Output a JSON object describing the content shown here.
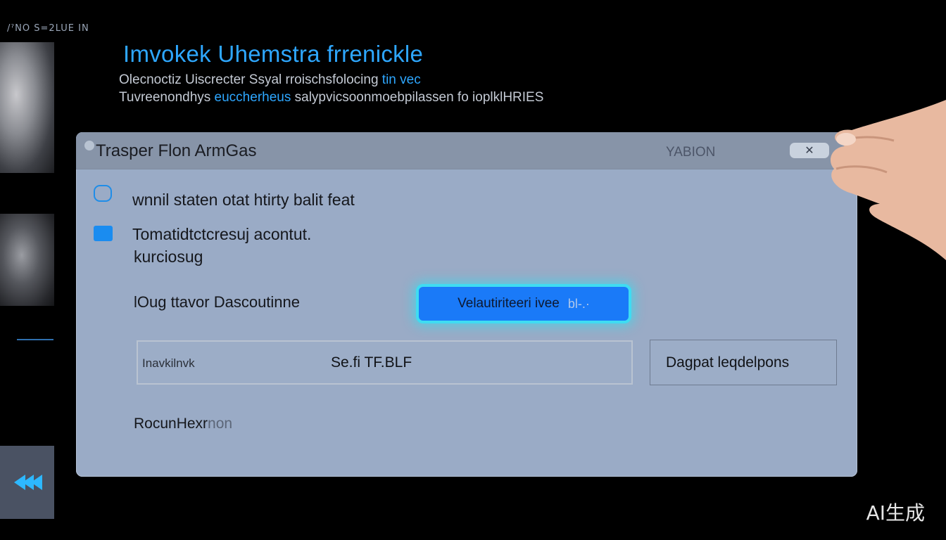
{
  "breadcrumb": "/ˀNO S=2LUE IN",
  "header": {
    "title": "Imvokek    Uhemstra frrenickle",
    "subtitle_line1_a": "Olecnoctiz Uiscrecter Ssyal rroischsfolocing ",
    "subtitle_line1_b": "tin vec",
    "subtitle_line2_a": "Tuvreenondhys ",
    "subtitle_line2_b": "euccherheus",
    "subtitle_line2_c": " salypvicsoonmoebpilassen fo ioplklHRIES"
  },
  "dialog": {
    "title": "Trasper Flon ArmGas",
    "header_link": "YABION",
    "close_label": "✕",
    "option1_label": "wnnil staten otat htirty balit feat",
    "option2_label": "Tomatidtctcresuj acontut.",
    "option2_sub": "kurciosug",
    "field_label": "lOug ttavor Dascoutinne",
    "primary_button_label": "Velautiriteeri ivee",
    "primary_button_suffix": "bl-.·",
    "input_label": "Inavkilnvk",
    "input_value": "Se.fi TF.BLF",
    "secondary_button_label": "Dagpat  leqdelpons",
    "footer_link_main": "RocunHexr",
    "footer_link_faded": "non"
  },
  "watermark": "AI生成",
  "colors": {
    "accent": "#2ea7ff",
    "primary_button": "#1a7af8",
    "button_glow": "#3fdcf2",
    "dialog_bg": "#9aabc6"
  }
}
